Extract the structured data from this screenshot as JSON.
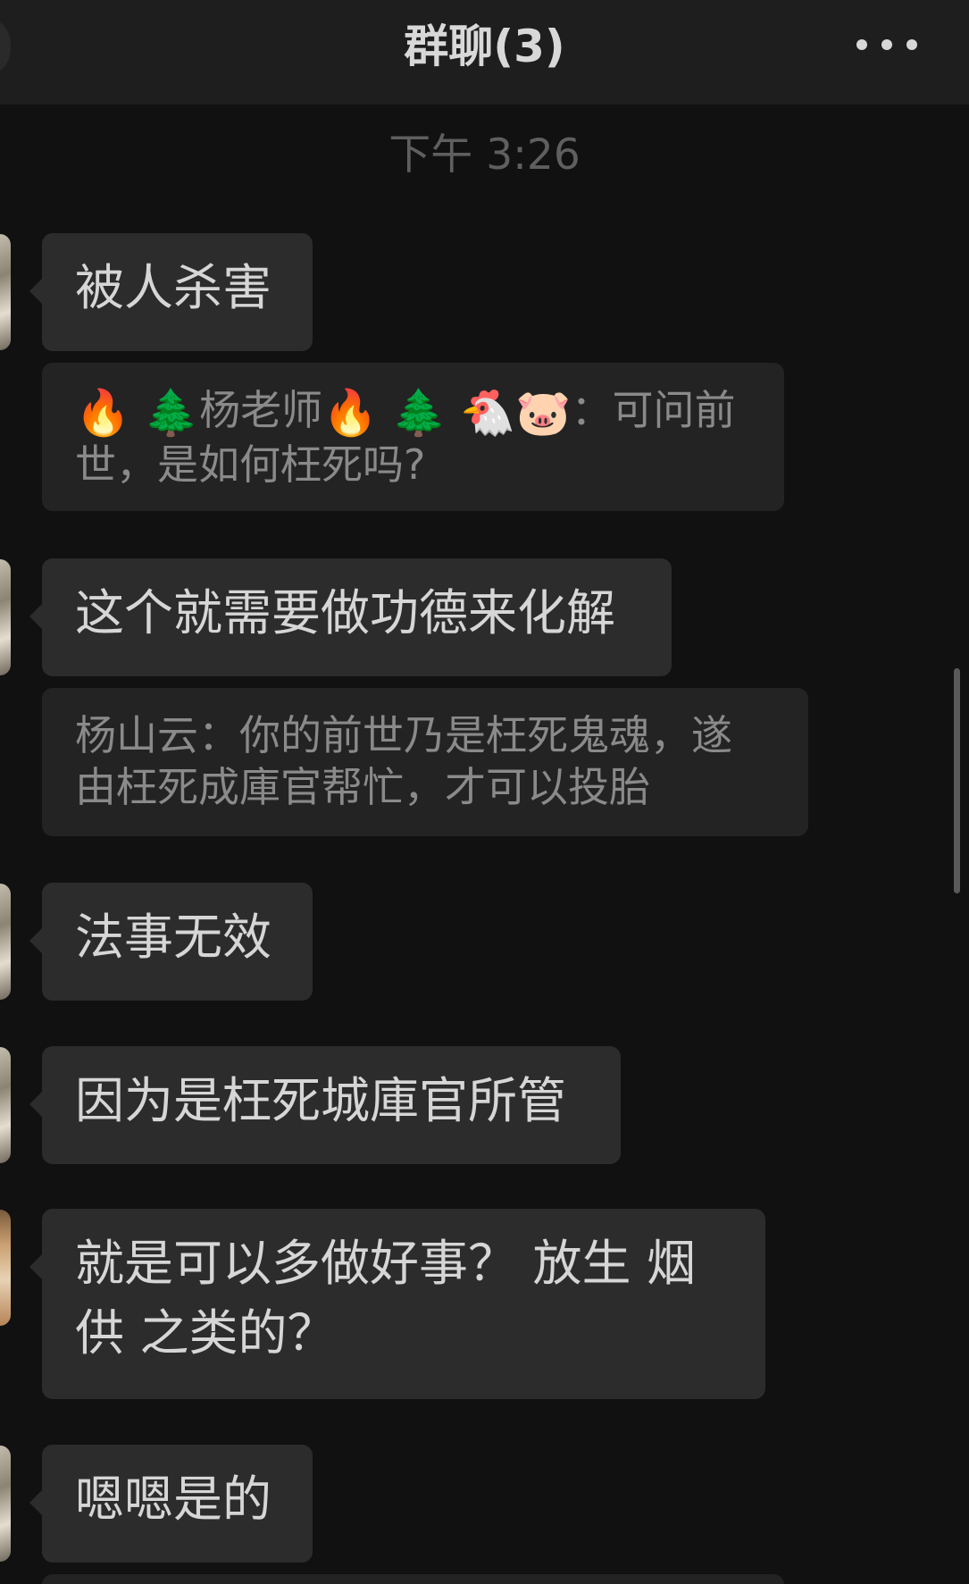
{
  "header": {
    "title": "群聊(3)",
    "more_icon": "more-dots-icon"
  },
  "timestamp": "下午 3:26",
  "messages": [
    {
      "text": "被人杀害"
    },
    {
      "quote_emojis": [
        "🔥",
        "🌲"
      ],
      "quote_name": "杨老师",
      "quote_emojis2": [
        "🔥",
        "🌲",
        "🐔",
        "🐷"
      ],
      "quote_text_line1": "：可问前",
      "quote_text_line2": "世，是如何枉死吗?"
    },
    {
      "text": "这个就需要做功德来化解"
    },
    {
      "quote_text_line1": "杨山云：你的前世乃是枉死鬼魂，遂",
      "quote_text_line2": "由枉死成庫官帮忙，才可以投胎"
    },
    {
      "text": "法事无效"
    },
    {
      "text": "因为是枉死城庫官所管"
    },
    {
      "text_line1": "就是可以多做好事？ 放生 烟",
      "text_line2": "供 之类的？"
    },
    {
      "text": "嗯嗯是的"
    }
  ]
}
